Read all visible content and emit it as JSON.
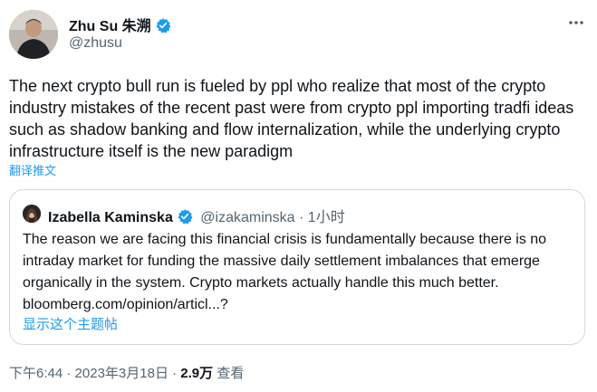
{
  "author": {
    "display_name": "Zhu Su 朱溯",
    "handle": "@zhusu"
  },
  "tweet": {
    "text": "The next crypto bull run is fueled by ppl who realize that most of the crypto industry mistakes of the recent past were from crypto ppl importing tradfi ideas such as shadow banking and flow internalization, while the underlying crypto infrastructure itself is the new paradigm",
    "translate_label": "翻译推文"
  },
  "quote": {
    "display_name": "Izabella Kaminska",
    "handle": "@izakaminska",
    "separator": " · ",
    "time": "1小时",
    "text": "The reason we are facing this financial crisis is fundamentally because there is no intraday market for funding the massive daily settlement imbalances that emerge organically in the system. Crypto markets actually handle this much better. bloomberg.com/opinion/articl...?",
    "thread_label": "显示这个主题帖"
  },
  "footer": {
    "time": "下午6:44",
    "separator": " · ",
    "date": "2023年3月18日",
    "views_count": "2.9万",
    "views_label": "查看"
  },
  "colors": {
    "verified": "#1d9bf0",
    "link": "#1d9bf0",
    "muted": "#536471",
    "border": "#cfd9de"
  },
  "icons": [
    "avatar",
    "verified-badge-icon",
    "more-options-icon"
  ]
}
